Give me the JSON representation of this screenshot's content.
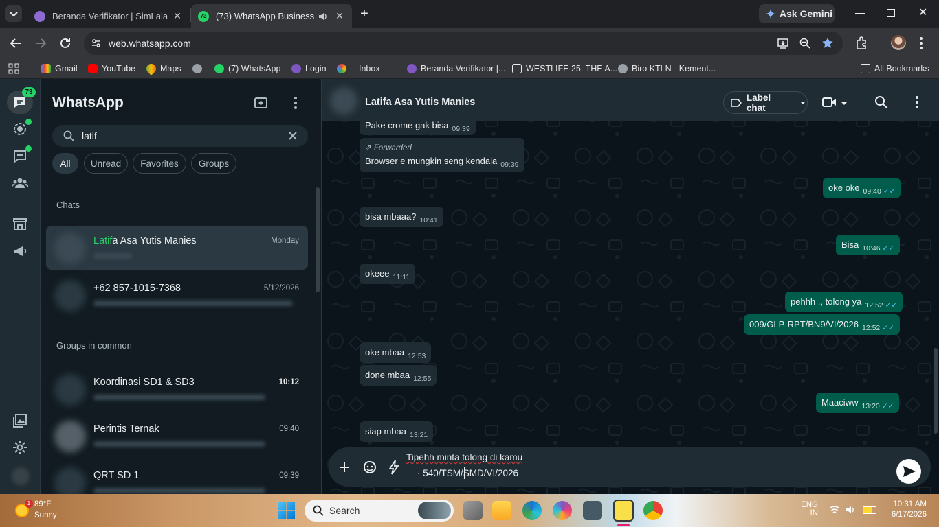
{
  "browser": {
    "tabs": [
      {
        "title": "Beranda Verifikator | SimLala",
        "active": false
      },
      {
        "title": "(73) WhatsApp Business",
        "active": true,
        "favicon_badge": "73"
      }
    ],
    "ask_gemini": "Ask Gemini",
    "url": "web.whatsapp.com",
    "bookmarks": [
      "Gmail",
      "YouTube",
      "Maps",
      "(7) WhatsApp",
      "Login",
      "Inbox",
      "Beranda Verifikator |...",
      "WESTLIFE 25: THE A...",
      "Biro KTLN - Kement..."
    ],
    "all_bookmarks": "All Bookmarks"
  },
  "whatsapp": {
    "rail": {
      "chats_badge": "73"
    },
    "app_title": "WhatsApp",
    "search": {
      "value": "latif"
    },
    "filters": [
      "All",
      "Unread",
      "Favorites",
      "Groups"
    ],
    "sections": {
      "chats": "Chats",
      "groups": "Groups in common"
    },
    "chats": [
      {
        "name_match": "Latif",
        "name_rest": "a Asa Yutis Manies",
        "time": "Monday"
      },
      {
        "name": "+62 857-1015-7368",
        "time": "5/12/2026"
      }
    ],
    "groups": [
      {
        "name": "Koordinasi SD1 & SD3",
        "time": "10:12",
        "unread_time": true
      },
      {
        "name": "Perintis Ternak",
        "time": "09:40"
      },
      {
        "name": "QRT SD 1",
        "time": "09:39"
      }
    ],
    "conversation": {
      "contact": "Latifa Asa Yutis Manies",
      "label_chat": "Label chat",
      "messages": [
        {
          "dir": "in",
          "text": "Pake crome gak bisa",
          "time": "09:39"
        },
        {
          "dir": "in",
          "forwarded": "Forwarded",
          "text": "Browser e mungkin seng kendala",
          "time": "09:39"
        },
        {
          "dir": "out",
          "text": "oke oke",
          "time": "09:40"
        },
        {
          "dir": "in",
          "text": "bisa mbaaa?",
          "time": "10:41"
        },
        {
          "dir": "out",
          "text": "Bisa",
          "time": "10:46"
        },
        {
          "dir": "in",
          "text": "okeee",
          "time": "11:11"
        },
        {
          "dir": "out",
          "text": "pehhh ,, tolong ya",
          "time": "12:52"
        },
        {
          "dir": "out",
          "text": "009/GLP-RPT/BN9/VI/2026",
          "time": "12:52"
        },
        {
          "dir": "in",
          "text": "oke mbaa",
          "time": "12:53"
        },
        {
          "dir": "in",
          "text": "done mbaa",
          "time": "12:55"
        },
        {
          "dir": "out",
          "text": "Maaciww",
          "time": "13:20"
        },
        {
          "dir": "in",
          "text": "siap mbaa",
          "time": "13:21"
        }
      ],
      "draft_line1": "Tipehh minta tolong di kamu",
      "draft_line2": "· 540/TSM/SMD/VI/2026"
    }
  },
  "taskbar": {
    "weather_temp": "89°F",
    "weather_desc": "Sunny",
    "weather_badge": "1",
    "search": "Search",
    "lang1": "ENG",
    "lang2": "IN",
    "time": "10:31 AM",
    "date": "6/17/2026"
  },
  "colors": {
    "wa_green": "#25d366",
    "outgoing": "#005c4b",
    "incoming": "#202c33",
    "read_ticks": "#53bdeb"
  }
}
